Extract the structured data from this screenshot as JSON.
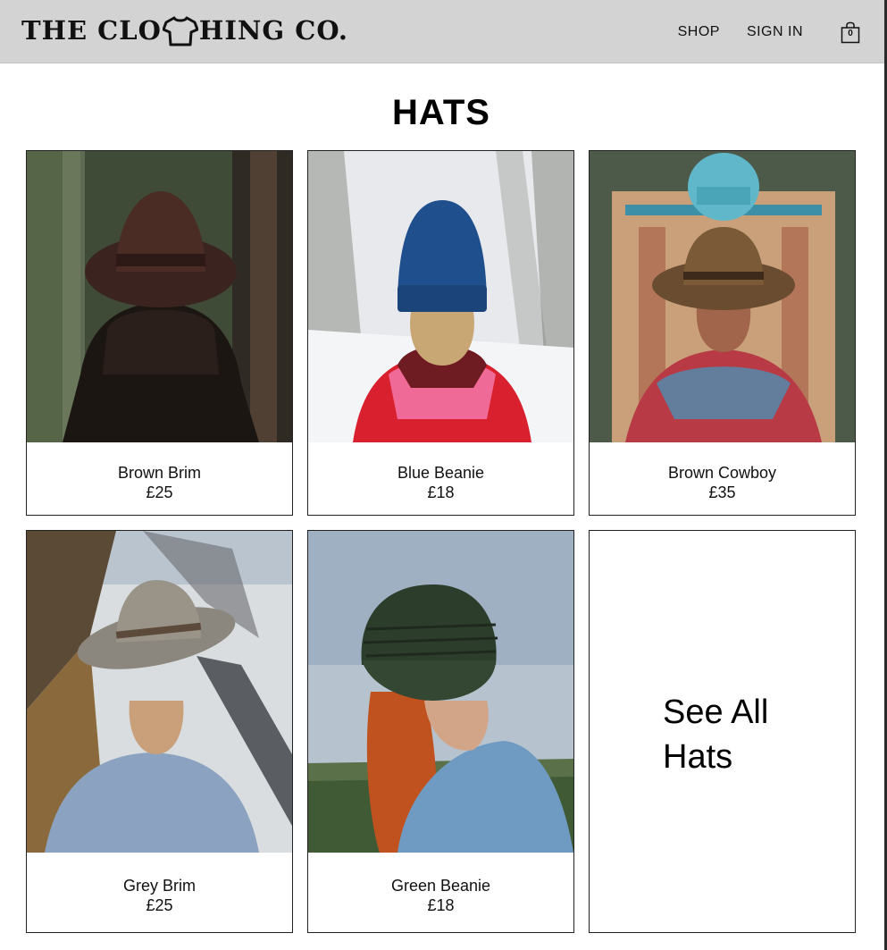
{
  "header": {
    "logo": {
      "before": "THE CLO",
      "after": "HING CO."
    },
    "nav": {
      "shop": "SHOP",
      "sign_in": "SIGN IN"
    },
    "cart": {
      "count": "0",
      "icon": "shopping-bag-icon"
    }
  },
  "page": {
    "title": "HATS"
  },
  "products": [
    {
      "name": "Brown Brim",
      "price": "£25"
    },
    {
      "name": "Blue Beanie",
      "price": "£18"
    },
    {
      "name": "Brown Cowboy",
      "price": "£35"
    },
    {
      "name": "Grey Brim",
      "price": "£25"
    },
    {
      "name": "Green Beanie",
      "price": "£18"
    }
  ],
  "see_all": {
    "label": "See All Hats"
  },
  "colors": {
    "header_bg": "#d3d3d3",
    "text": "#111111",
    "border": "#222222"
  }
}
